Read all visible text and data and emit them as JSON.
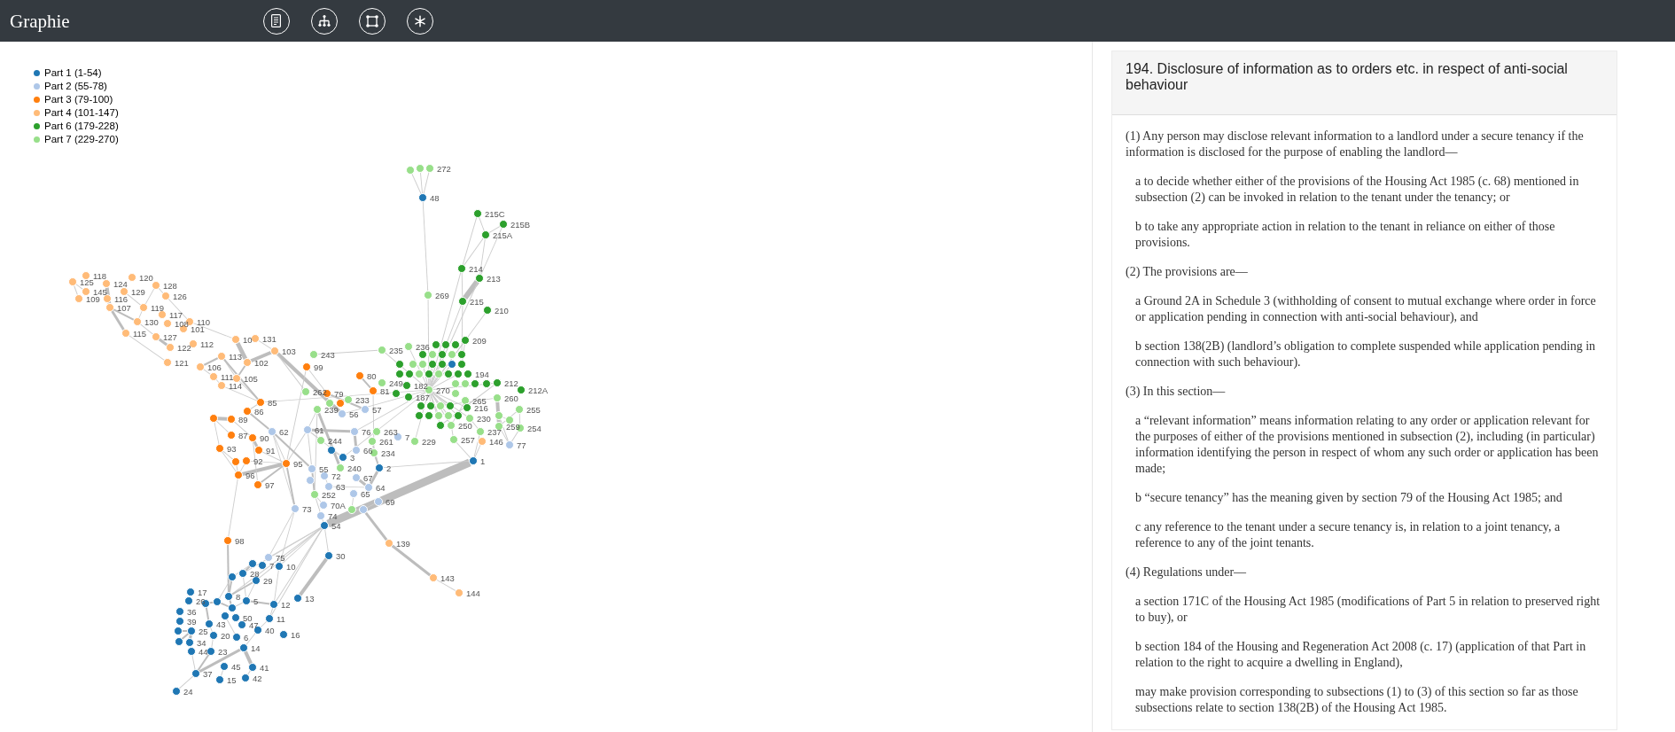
{
  "app": {
    "title": "Graphie"
  },
  "legend": [
    {
      "label": "Part 1 (1-54)",
      "color": "#1f77b4"
    },
    {
      "label": "Part 2 (55-78)",
      "color": "#aec7e8"
    },
    {
      "label": "Part 3 (79-100)",
      "color": "#ff7f0e"
    },
    {
      "label": "Part 4 (101-147)",
      "color": "#ffbb78"
    },
    {
      "label": "Part 6 (179-228)",
      "color": "#2ca02c"
    },
    {
      "label": "Part 7 (229-270)",
      "color": "#98df8a"
    }
  ],
  "graph": {
    "nodes": [
      {
        "color": "#98df8a"
      },
      {
        "color": "#98df8a"
      },
      {
        "label": "272",
        "color": "#98df8a"
      },
      {
        "label": "48",
        "color": "#1f77b4"
      },
      {
        "label": "215C",
        "color": "#2ca02c"
      },
      {
        "label": "215B",
        "color": "#2ca02c"
      },
      {
        "label": "215A",
        "color": "#2ca02c"
      },
      {
        "label": "214",
        "color": "#2ca02c"
      },
      {
        "label": "125",
        "color": "#ffbb78"
      },
      {
        "label": "118",
        "color": "#ffbb78"
      },
      {
        "label": "124",
        "color": "#ffbb78"
      },
      {
        "label": "120",
        "color": "#ffbb78"
      },
      {
        "label": "128",
        "color": "#ffbb78"
      },
      {
        "label": "213",
        "color": "#2ca02c"
      },
      {
        "label": "145",
        "color": "#ffbb78"
      },
      {
        "label": "129",
        "color": "#ffbb78"
      },
      {
        "label": "109",
        "color": "#ffbb78"
      },
      {
        "label": "116",
        "color": "#ffbb78"
      },
      {
        "label": "126",
        "color": "#ffbb78"
      },
      {
        "label": "269",
        "color": "#98df8a"
      },
      {
        "label": "215",
        "color": "#2ca02c"
      },
      {
        "label": "107",
        "color": "#ffbb78"
      },
      {
        "label": "119",
        "color": "#ffbb78"
      },
      {
        "label": "117",
        "color": "#ffbb78"
      },
      {
        "label": "210",
        "color": "#2ca02c"
      },
      {
        "label": "130",
        "color": "#ffbb78"
      },
      {
        "label": "108",
        "color": "#ffbb78"
      },
      {
        "label": "110",
        "color": "#ffbb78"
      },
      {
        "label": "115",
        "color": "#ffbb78"
      },
      {
        "label": "127",
        "color": "#ffbb78"
      },
      {
        "label": "101",
        "color": "#ffbb78"
      },
      {
        "label": "10",
        "color": "#ffbb78"
      },
      {
        "label": "131",
        "color": "#ffbb78"
      },
      {
        "label": "209",
        "color": "#2ca02c"
      },
      {
        "label": "122",
        "color": "#ffbb78"
      },
      {
        "label": "112",
        "color": "#ffbb78"
      },
      {
        "label": "236",
        "color": "#98df8a"
      },
      {
        "color": "#2ca02c"
      },
      {
        "color": "#2ca02c"
      },
      {
        "color": "#2ca02c"
      },
      {
        "label": "103",
        "color": "#ffbb78"
      },
      {
        "label": "235",
        "color": "#98df8a"
      },
      {
        "label": "113",
        "color": "#ffbb78"
      },
      {
        "label": "243",
        "color": "#98df8a"
      },
      {
        "color": "#2ca02c"
      },
      {
        "color": "#98df8a"
      },
      {
        "color": "#2ca02c"
      },
      {
        "color": "#98df8a"
      },
      {
        "color": "#2ca02c"
      },
      {
        "label": "121",
        "color": "#ffbb78"
      },
      {
        "label": "106",
        "color": "#ffbb78"
      },
      {
        "label": "102",
        "color": "#ffbb78"
      },
      {
        "label": "99",
        "color": "#ff7f0e"
      },
      {
        "color": "#2ca02c"
      },
      {
        "color": "#98df8a"
      },
      {
        "color": "#98df8a"
      },
      {
        "color": "#2ca02c"
      },
      {
        "color": "#2ca02c"
      },
      {
        "color": "#1f77b4"
      },
      {
        "color": "#2ca02c"
      },
      {
        "label": "111",
        "color": "#ffbb78"
      },
      {
        "label": "105",
        "color": "#ffbb78"
      },
      {
        "label": "80",
        "color": "#ff7f0e"
      },
      {
        "color": "#2ca02c"
      },
      {
        "color": "#2ca02c"
      },
      {
        "color": "#98df8a"
      },
      {
        "color": "#2ca02c"
      },
      {
        "color": "#98df8a"
      },
      {
        "color": "#2ca02c"
      },
      {
        "color": "#2ca02c"
      },
      {
        "label": "194",
        "color": "#2ca02c"
      },
      {
        "label": "114",
        "color": "#ffbb78"
      },
      {
        "label": "249",
        "color": "#98df8a"
      },
      {
        "label": "182",
        "color": "#2ca02c"
      },
      {
        "color": "#98df8a"
      },
      {
        "color": "#98df8a"
      },
      {
        "color": "#2ca02c"
      },
      {
        "color": "#2ca02c"
      },
      {
        "label": "212",
        "color": "#2ca02c"
      },
      {
        "label": "262",
        "color": "#98df8a"
      },
      {
        "label": "79",
        "color": "#ff7f0e"
      },
      {
        "label": "81",
        "color": "#ff7f0e"
      },
      {
        "color": "#2ca02c"
      },
      {
        "label": "270",
        "color": "#98df8a"
      },
      {
        "color": "#98df8a"
      },
      {
        "label": "212A",
        "color": "#2ca02c"
      },
      {
        "label": "85",
        "color": "#ff7f0e"
      },
      {
        "color": "#98df8a"
      },
      {
        "color": "#ff7f0e"
      },
      {
        "label": "233",
        "color": "#98df8a"
      },
      {
        "label": "187",
        "color": "#2ca02c"
      },
      {
        "color": "#2ca02c"
      },
      {
        "color": "#2ca02c"
      },
      {
        "color": "#98df8a"
      },
      {
        "color": "#2ca02c"
      },
      {
        "label": "265",
        "color": "#98df8a"
      },
      {
        "label": "260",
        "color": "#98df8a"
      },
      {
        "label": "86",
        "color": "#ff7f0e"
      },
      {
        "label": "239",
        "color": "#98df8a"
      },
      {
        "label": "56",
        "color": "#aec7e8"
      },
      {
        "label": "57",
        "color": "#aec7e8"
      },
      {
        "color": "#2ca02c"
      },
      {
        "color": "#2ca02c"
      },
      {
        "color": "#98df8a"
      },
      {
        "color": "#98df8a"
      },
      {
        "color": "#2ca02c"
      },
      {
        "label": "216",
        "color": "#2ca02c"
      },
      {
        "color": "#98df8a"
      },
      {
        "label": "255",
        "color": "#98df8a"
      },
      {
        "color": "#ff7f0e"
      },
      {
        "label": "89",
        "color": "#ff7f0e"
      },
      {
        "label": "62",
        "color": "#aec7e8"
      },
      {
        "label": "61",
        "color": "#aec7e8"
      },
      {
        "label": "76",
        "color": "#aec7e8"
      },
      {
        "label": "263",
        "color": "#98df8a"
      },
      {
        "color": "#2ca02c"
      },
      {
        "label": "250",
        "color": "#98df8a"
      },
      {
        "label": "230",
        "color": "#98df8a"
      },
      {
        "label": "237",
        "color": "#98df8a"
      },
      {
        "label": "259",
        "color": "#98df8a"
      },
      {
        "color": "#98df8a"
      },
      {
        "label": "254",
        "color": "#98df8a"
      },
      {
        "label": "87",
        "color": "#ff7f0e"
      },
      {
        "label": "90",
        "color": "#ff7f0e"
      },
      {
        "label": "244",
        "color": "#98df8a"
      },
      {
        "label": "261",
        "color": "#98df8a"
      },
      {
        "label": "7",
        "color": "#aec7e8"
      },
      {
        "label": "229",
        "color": "#98df8a"
      },
      {
        "label": "257",
        "color": "#98df8a"
      },
      {
        "label": "146",
        "color": "#ffbb78"
      },
      {
        "label": "93",
        "color": "#ff7f0e"
      },
      {
        "label": "91",
        "color": "#ff7f0e"
      },
      {
        "color": "#1f77b4"
      },
      {
        "label": "66",
        "color": "#aec7e8"
      },
      {
        "label": "234",
        "color": "#98df8a"
      },
      {
        "label": "77",
        "color": "#aec7e8"
      },
      {
        "color": "#ff7f0e"
      },
      {
        "label": "92",
        "color": "#ff7f0e"
      },
      {
        "label": "95",
        "color": "#ff7f0e"
      },
      {
        "label": "3",
        "color": "#1f77b4"
      },
      {
        "label": "1",
        "color": "#1f77b4"
      },
      {
        "label": "55",
        "color": "#aec7e8"
      },
      {
        "label": "240",
        "color": "#98df8a"
      },
      {
        "label": "2",
        "color": "#1f77b4"
      },
      {
        "label": "96",
        "color": "#ff7f0e"
      },
      {
        "label": "72",
        "color": "#aec7e8"
      },
      {
        "label": "67",
        "color": "#aec7e8"
      },
      {
        "label": "97",
        "color": "#ff7f0e"
      },
      {
        "color": "#aec7e8"
      },
      {
        "label": "63",
        "color": "#aec7e8"
      },
      {
        "label": "64",
        "color": "#aec7e8"
      },
      {
        "label": "252",
        "color": "#98df8a"
      },
      {
        "label": "65",
        "color": "#aec7e8"
      },
      {
        "label": "70A",
        "color": "#aec7e8"
      },
      {
        "label": "69",
        "color": "#aec7e8"
      },
      {
        "label": "73",
        "color": "#aec7e8"
      },
      {
        "color": "#98df8a"
      },
      {
        "color": "#aec7e8"
      },
      {
        "label": "74",
        "color": "#aec7e8"
      },
      {
        "label": "54",
        "color": "#1f77b4"
      },
      {
        "label": "98",
        "color": "#ff7f0e"
      },
      {
        "label": "139",
        "color": "#ffbb78"
      },
      {
        "label": "75",
        "color": "#aec7e8"
      },
      {
        "label": "30",
        "color": "#1f77b4"
      },
      {
        "color": "#1f77b4"
      },
      {
        "label": "7",
        "color": "#1f77b4"
      },
      {
        "label": "10",
        "color": "#1f77b4"
      },
      {
        "color": "#1f77b4"
      },
      {
        "label": "28",
        "color": "#1f77b4"
      },
      {
        "label": "29",
        "color": "#1f77b4"
      },
      {
        "label": "143",
        "color": "#ffbb78"
      },
      {
        "label": "17",
        "color": "#1f77b4"
      },
      {
        "label": "8",
        "color": "#1f77b4"
      },
      {
        "label": "13",
        "color": "#1f77b4"
      },
      {
        "label": "144",
        "color": "#ffbb78"
      },
      {
        "label": "26",
        "color": "#1f77b4"
      },
      {
        "color": "#1f77b4"
      },
      {
        "color": "#1f77b4"
      },
      {
        "label": "5",
        "color": "#1f77b4"
      },
      {
        "label": "12",
        "color": "#1f77b4"
      },
      {
        "label": "36",
        "color": "#1f77b4"
      },
      {
        "color": "#1f77b4"
      },
      {
        "label": "39",
        "color": "#1f77b4"
      },
      {
        "label": "43",
        "color": "#1f77b4"
      },
      {
        "color": "#1f77b4"
      },
      {
        "label": "50",
        "color": "#1f77b4"
      },
      {
        "label": "47",
        "color": "#1f77b4"
      },
      {
        "label": "11",
        "color": "#1f77b4"
      },
      {
        "color": "#1f77b4"
      },
      {
        "label": "25",
        "color": "#1f77b4"
      },
      {
        "label": "20",
        "color": "#1f77b4"
      },
      {
        "label": "6",
        "color": "#1f77b4"
      },
      {
        "label": "40",
        "color": "#1f77b4"
      },
      {
        "label": "16",
        "color": "#1f77b4"
      },
      {
        "color": "#1f77b4"
      },
      {
        "label": "34",
        "color": "#1f77b4"
      },
      {
        "label": "44",
        "color": "#1f77b4"
      },
      {
        "label": "23",
        "color": "#1f77b4"
      },
      {
        "label": "14",
        "color": "#1f77b4"
      },
      {
        "label": "45",
        "color": "#1f77b4"
      },
      {
        "label": "41",
        "color": "#1f77b4"
      },
      {
        "label": "37",
        "color": "#1f77b4"
      },
      {
        "label": "15",
        "color": "#1f77b4"
      },
      {
        "label": "42",
        "color": "#1f77b4"
      },
      {
        "label": "24",
        "color": "#1f77b4"
      }
    ]
  },
  "article": {
    "title": "194. Disclosure of information as to orders etc. in respect of anti-social behaviour",
    "paragraphs": [
      {
        "kind": "subsection",
        "text": "(1) Any person may disclose relevant information to a landlord under a secure tenancy if the information is disclosed for the purpose of enabling the landlord—"
      },
      {
        "kind": "item",
        "text": "a to decide whether either of the provisions of the Housing Act 1985 (c. 68) mentioned in subsection (2) can be invoked in relation to the tenant under the tenancy; or"
      },
      {
        "kind": "item",
        "text": "b to take any appropriate action in relation to the tenant in reliance on either of those provisions."
      },
      {
        "kind": "subsection",
        "text": "(2) The provisions are—"
      },
      {
        "kind": "item",
        "text": "a Ground 2A in Schedule 3 (withholding of consent to mutual exchange where order in force or application pending in connection with anti-social behaviour), and"
      },
      {
        "kind": "item",
        "text": "b section 138(2B) (landlord’s obligation to complete suspended while application pending in connection with such behaviour)."
      },
      {
        "kind": "subsection",
        "text": "(3) In this section—"
      },
      {
        "kind": "item",
        "text": "a “relevant information” means information relating to any order or application relevant for the purposes of either of the provisions mentioned in subsection (2), including (in particular) information identifying the person in respect of whom any such order or application has been made;"
      },
      {
        "kind": "item",
        "text": "b “secure tenancy” has the meaning given by section 79 of the Housing Act 1985; and"
      },
      {
        "kind": "item",
        "text": "c any reference to the tenant under a secure tenancy is, in relation to a joint tenancy, a reference to any of the joint tenants."
      },
      {
        "kind": "subsection",
        "text": "(4) Regulations under—"
      },
      {
        "kind": "item",
        "text": "a section 171C of the Housing Act 1985 (modifications of Part 5 in relation to preserved right to buy), or"
      },
      {
        "kind": "item",
        "text": "b section 184 of the Housing and Regeneration Act 2008 (c. 17) (application of that Part in relation to the right to acquire a dwelling in England),"
      },
      {
        "kind": "item",
        "text": "may make provision corresponding to subsections (1) to (3) of this section so far as those subsections relate to section 138(2B) of the Housing Act 1985."
      }
    ]
  }
}
